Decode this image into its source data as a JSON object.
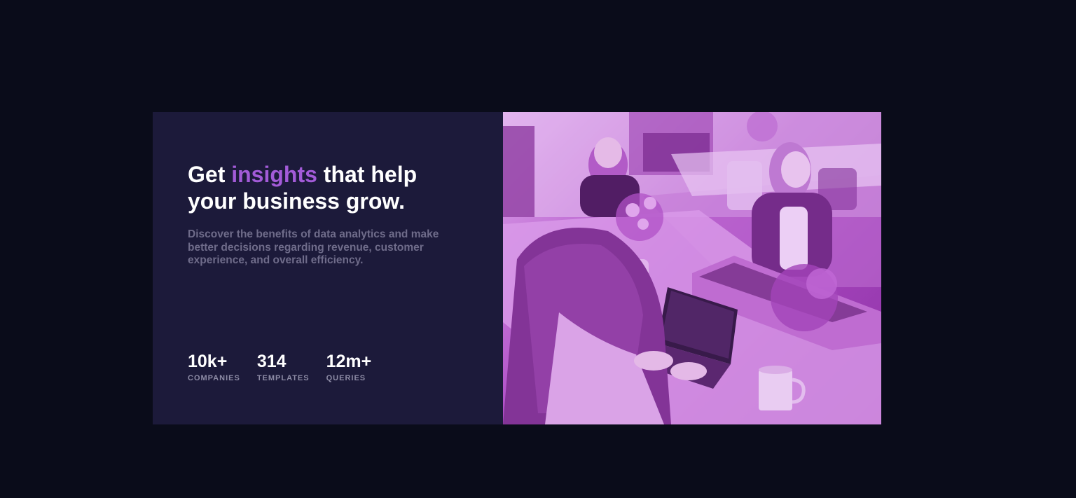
{
  "hero": {
    "headline_part1": "Get ",
    "headline_accent": "insights",
    "headline_part2": " that help your business grow.",
    "description": "Discover the benefits of data analytics and make better decisions regarding revenue, customer experience, and overall efficiency."
  },
  "stats": [
    {
      "value": "10k+",
      "label": "COMPANIES"
    },
    {
      "value": "314",
      "label": "TEMPLATES"
    },
    {
      "value": "12m+",
      "label": "QUERIES"
    }
  ],
  "image": {
    "alt": "People working in an office",
    "overlay_color": "#aa5cdb"
  },
  "colors": {
    "page_bg": "#0a0c1a",
    "card_bg": "#1c1a3a",
    "accent": "#a35bd8",
    "text_primary": "#ffffff",
    "text_muted": "#6f6c8a"
  }
}
